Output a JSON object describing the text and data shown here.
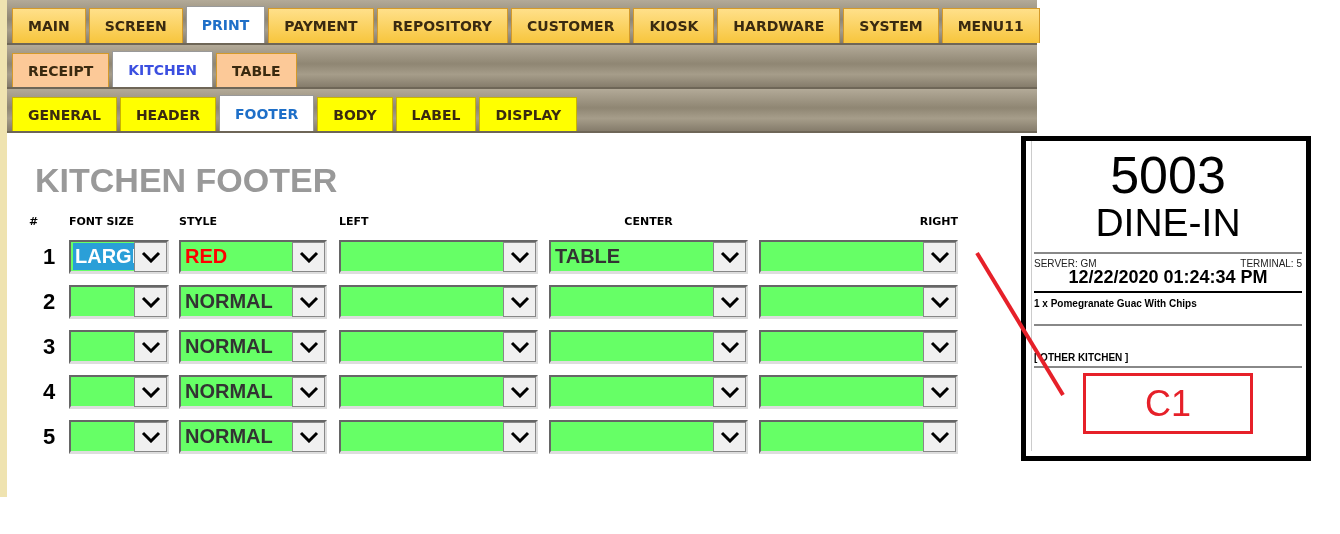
{
  "main_tabs": [
    {
      "label": "MAIN",
      "selected": false
    },
    {
      "label": "SCREEN",
      "selected": false
    },
    {
      "label": "PRINT",
      "selected": true
    },
    {
      "label": "PAYMENT",
      "selected": false
    },
    {
      "label": "REPOSITORY",
      "selected": false
    },
    {
      "label": "CUSTOMER",
      "selected": false
    },
    {
      "label": "KIOSK",
      "selected": false
    },
    {
      "label": "HARDWARE",
      "selected": false
    },
    {
      "label": "SYSTEM",
      "selected": false
    },
    {
      "label": "MENU11",
      "selected": false
    }
  ],
  "print_tabs": [
    {
      "label": "RECEIPT",
      "selected": false
    },
    {
      "label": "KITCHEN",
      "selected": true
    },
    {
      "label": "TABLE",
      "selected": false
    }
  ],
  "section_tabs": [
    {
      "label": "GENERAL",
      "selected": false
    },
    {
      "label": "HEADER",
      "selected": false
    },
    {
      "label": "FOOTER",
      "selected": true
    },
    {
      "label": "BODY",
      "selected": false
    },
    {
      "label": "LABEL",
      "selected": false
    },
    {
      "label": "DISPLAY",
      "selected": false
    }
  ],
  "title": "KITCHEN FOOTER",
  "columns": [
    "#",
    "FONT SIZE",
    "STYLE",
    "LEFT",
    "CENTER",
    "RIGHT"
  ],
  "rows": [
    {
      "number": "1",
      "font_size": {
        "value": "LARGI",
        "highlighted": true
      },
      "style": {
        "value": "RED",
        "color": "#ff0000"
      },
      "center": "TABLE"
    },
    {
      "number": "2",
      "font_size": {},
      "style": {
        "value": "NORMAL",
        "color": "#333333"
      }
    },
    {
      "number": "3",
      "font_size": {},
      "style": {
        "value": "NORMAL",
        "color": "#333333"
      }
    },
    {
      "number": "4",
      "font_size": {},
      "style": {
        "value": "NORMAL",
        "color": "#333333"
      }
    },
    {
      "number": "5",
      "font_size": {},
      "style": {
        "value": "NORMAL",
        "color": "#333333"
      }
    }
  ],
  "receipt": {
    "order_number": "5003",
    "order_type": "DINE-IN",
    "server": "SERVER: GM",
    "terminal": "TERMINAL: 5",
    "datetime": "12/22/2020 01:24:34 PM",
    "item": "1 x Pomegranate Guac With Chips",
    "kitchen": "[ OTHER KITCHEN ]",
    "callout": "C1"
  }
}
